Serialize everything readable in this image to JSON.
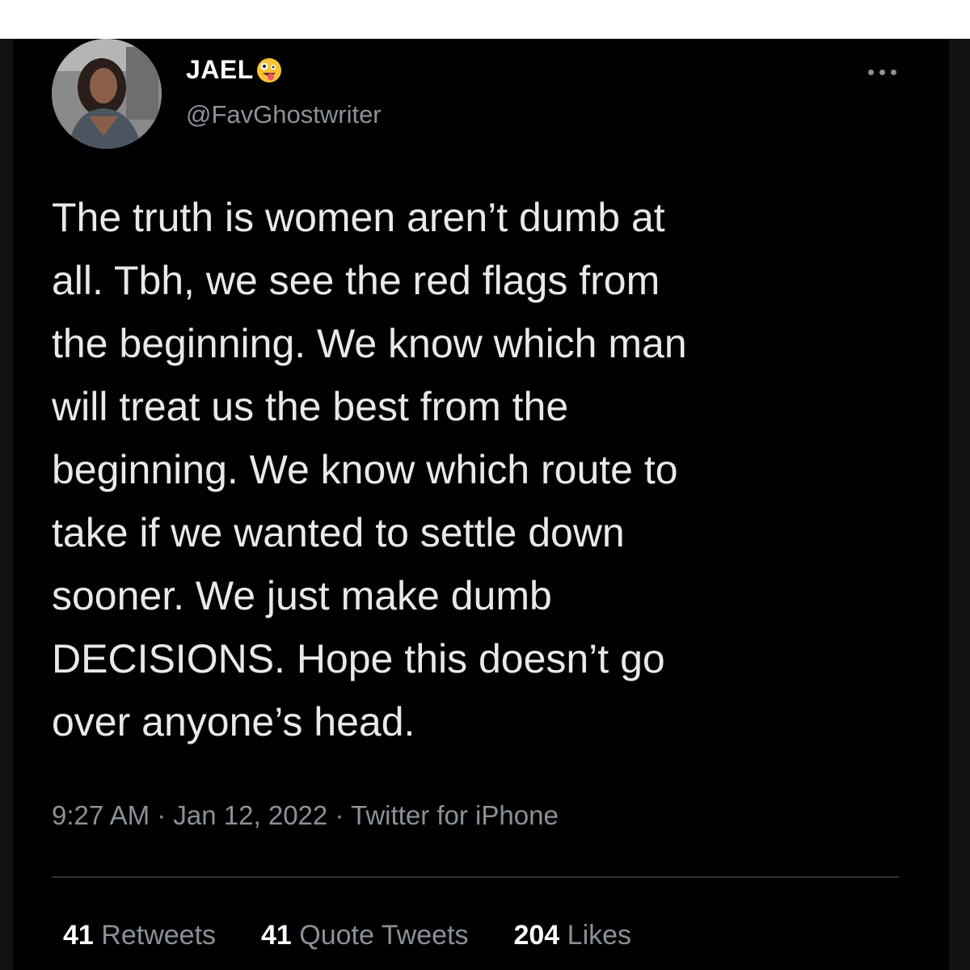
{
  "author": {
    "display_name": "JAEL",
    "name_emoji": "zany-face-emoji-icon",
    "handle": "@FavGhostwriter"
  },
  "tweet": {
    "lines": [
      "The truth is women aren’t dumb at",
      "all. Tbh, we see the red flags from",
      "the beginning. We know which man",
      "will treat us the best from the",
      "beginning. We know which route to",
      "take if we wanted to settle down",
      "sooner. We just make dumb",
      "DECISIONS. Hope this doesn’t go",
      "over anyone’s head."
    ],
    "time": "9:27 AM",
    "date": "Jan 12, 2022",
    "separator": "·",
    "source": "Twitter for iPhone"
  },
  "stats": {
    "retweets_count": "41",
    "retweets_label": "Retweets",
    "quotes_count": "41",
    "quotes_label": "Quote Tweets",
    "likes_count": "204",
    "likes_label": "Likes"
  },
  "colors": {
    "background": "#000000",
    "text": "#e7e9ea",
    "secondary": "#8b9198",
    "divider": "#2f3336"
  },
  "icons": {
    "more": "more-horizontal-icon"
  }
}
